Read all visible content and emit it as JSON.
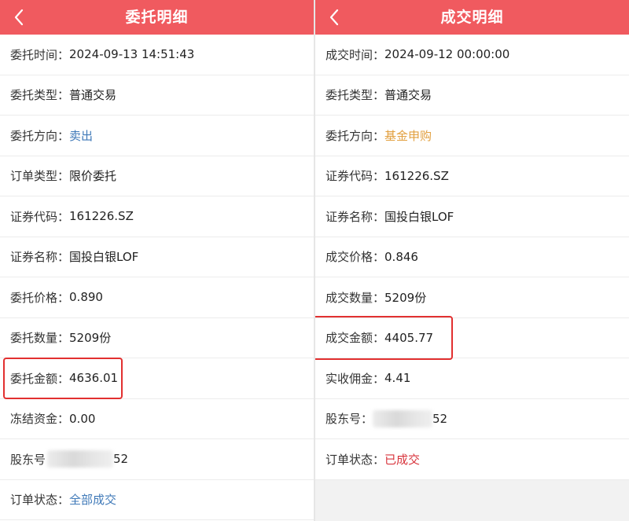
{
  "left": {
    "title": "委托明细",
    "rows": [
      {
        "label": "委托时间：",
        "value": "2024-09-13 14:51:43"
      },
      {
        "label": "委托类型：",
        "value": "普通交易"
      },
      {
        "label": "委托方向：",
        "value": "卖出",
        "color": "#3f79b8"
      },
      {
        "label": "订单类型：",
        "value": "限价委托"
      },
      {
        "label": "证券代码：",
        "value": "161226.SZ"
      },
      {
        "label": "证券名称：",
        "value": "国投白银LOF"
      },
      {
        "label": "委托价格：",
        "value": "0.890"
      },
      {
        "label": "委托数量：",
        "value": "5209份"
      },
      {
        "label": "委托金额：",
        "value": "4636.01"
      },
      {
        "label": "冻结资金：",
        "value": "0.00"
      },
      {
        "label": "股东号",
        "value": "52"
      },
      {
        "label": "订单状态：",
        "value": "全部成交",
        "color": "#3f79b8"
      }
    ]
  },
  "right": {
    "title": "成交明细",
    "rows": [
      {
        "label": "成交时间：",
        "value": "2024-09-12 00:00:00"
      },
      {
        "label": "委托类型：",
        "value": "普通交易"
      },
      {
        "label": "委托方向：",
        "value": "基金申购",
        "color": "#e2a040"
      },
      {
        "label": "证券代码：",
        "value": "161226.SZ"
      },
      {
        "label": "证券名称：",
        "value": "国投白银LOF"
      },
      {
        "label": "成交价格：",
        "value": "0.846"
      },
      {
        "label": "成交数量：",
        "value": "5209份"
      },
      {
        "label": "成交金额：",
        "value": "4405.77"
      },
      {
        "label": "实收佣金：",
        "value": "4.41"
      },
      {
        "label": "股东号：",
        "value": "52"
      },
      {
        "label": "订单状态：",
        "value": "已成交",
        "color": "#d8343c"
      }
    ]
  },
  "colors": {
    "header_bg": "#f05a5f",
    "highlight_box": "#e23030"
  },
  "icons": {
    "back": "chevron-left-icon"
  }
}
